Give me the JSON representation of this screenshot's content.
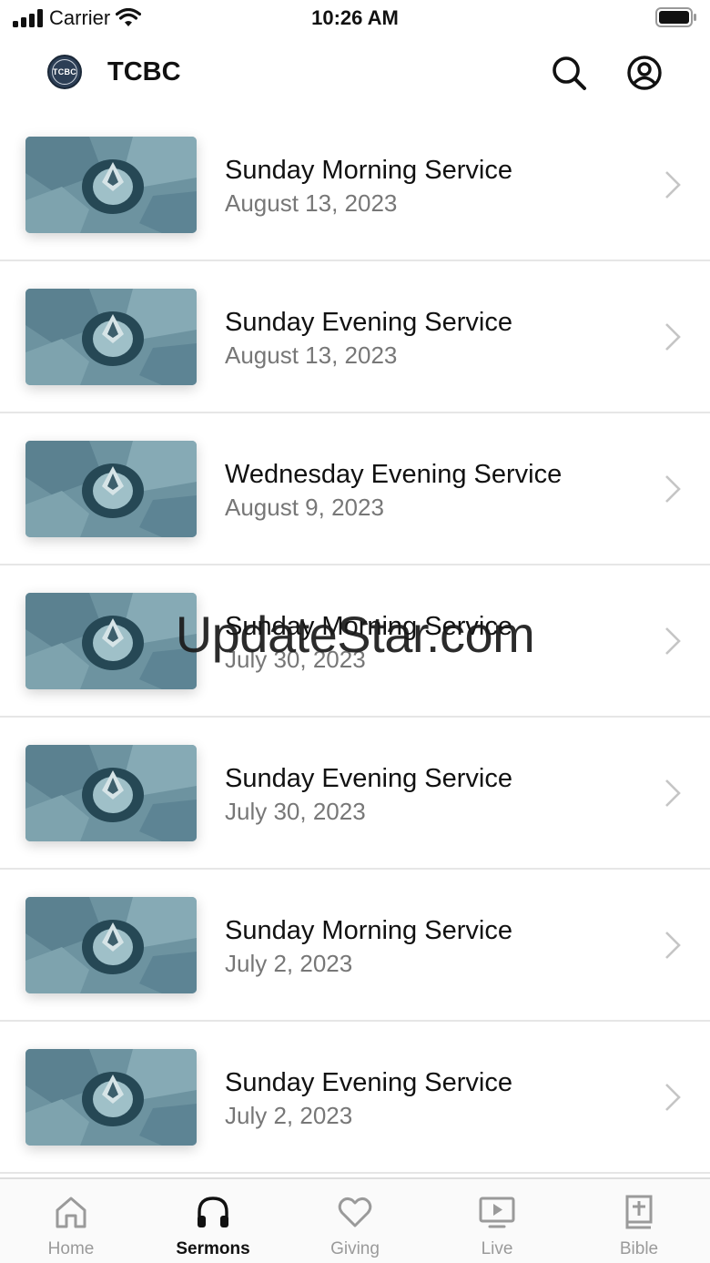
{
  "status_bar": {
    "carrier": "Carrier",
    "time": "10:26 AM"
  },
  "header": {
    "logo_text": "TCBC",
    "title": "TCBC"
  },
  "sermons": [
    {
      "title": "Sunday Morning Service",
      "date": "August 13, 2023"
    },
    {
      "title": "Sunday Evening Service",
      "date": "August 13, 2023"
    },
    {
      "title": "Wednesday Evening Service",
      "date": "August 9, 2023"
    },
    {
      "title": "Sunday Morning Service",
      "date": "July 30, 2023"
    },
    {
      "title": "Sunday Evening Service",
      "date": "July 30, 2023"
    },
    {
      "title": "Sunday Morning Service",
      "date": "July 2, 2023"
    },
    {
      "title": "Sunday Evening Service",
      "date": "July 2, 2023"
    }
  ],
  "watermark": "UpdateStar.com",
  "tabs": [
    {
      "label": "Home",
      "icon": "home-icon",
      "active": false
    },
    {
      "label": "Sermons",
      "icon": "headphones-icon",
      "active": true
    },
    {
      "label": "Giving",
      "icon": "heart-icon",
      "active": false
    },
    {
      "label": "Live",
      "icon": "tv-play-icon",
      "active": false
    },
    {
      "label": "Bible",
      "icon": "bible-icon",
      "active": false
    }
  ],
  "colors": {
    "active_tab": "#111111",
    "inactive_tab": "#9a9a9a",
    "date_text": "#777777",
    "thumbnail": "#7fa3ad"
  }
}
